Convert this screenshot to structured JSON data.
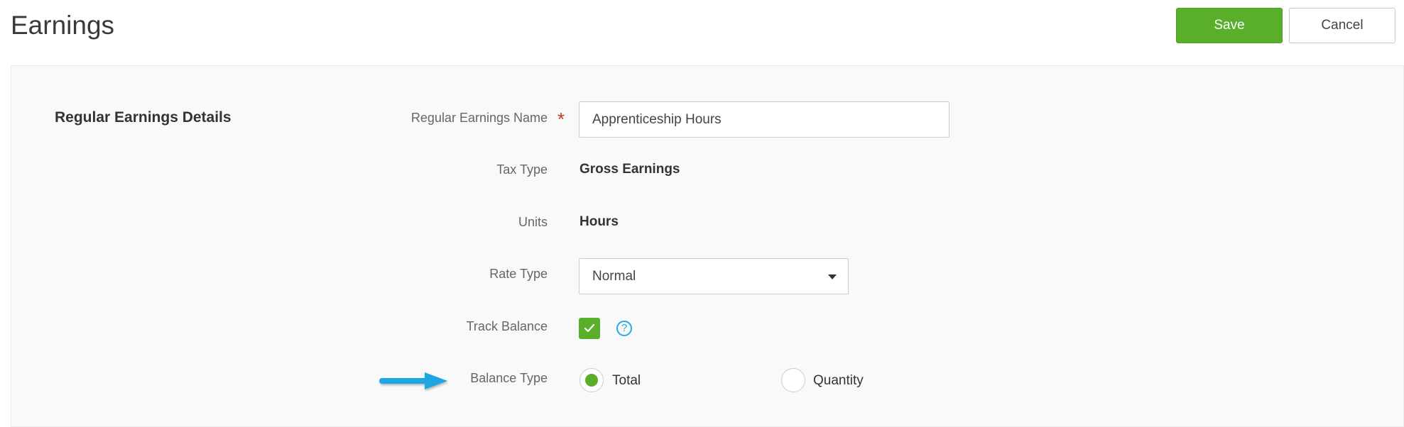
{
  "header": {
    "title": "Earnings",
    "save_label": "Save",
    "cancel_label": "Cancel"
  },
  "section": {
    "title": "Regular Earnings Details"
  },
  "fields": {
    "name": {
      "label": "Regular Earnings Name",
      "required_mark": "*",
      "value": "Apprenticeship Hours"
    },
    "tax_type": {
      "label": "Tax Type",
      "value": "Gross Earnings"
    },
    "units": {
      "label": "Units",
      "value": "Hours"
    },
    "rate_type": {
      "label": "Rate Type",
      "value": "Normal"
    },
    "track_balance": {
      "label": "Track Balance",
      "checked": true,
      "help_icon": "question-circle-icon",
      "help_glyph": "?"
    },
    "balance_type": {
      "label": "Balance Type",
      "options": [
        {
          "label": "Total",
          "selected": true
        },
        {
          "label": "Quantity",
          "selected": false
        }
      ]
    }
  },
  "colors": {
    "accent_green": "#5aaf2a",
    "help_blue": "#27a9e1",
    "arrow_blue": "#1ea7e4",
    "required_red": "#c0392b"
  }
}
